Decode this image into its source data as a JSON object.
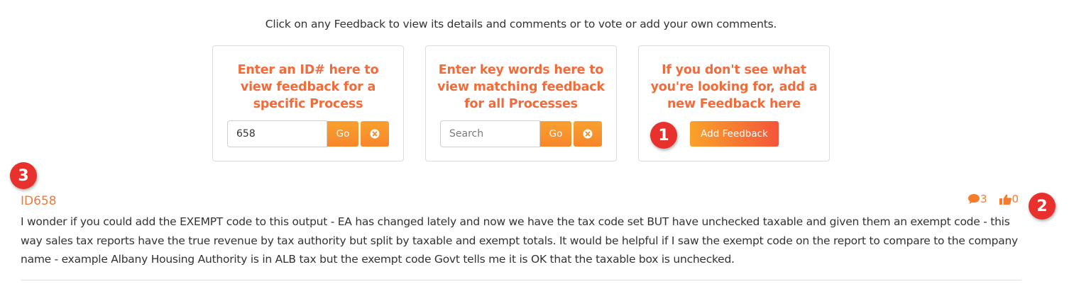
{
  "intro": "Click on any Feedback to view its details and comments or to vote or add your own comments.",
  "panels": {
    "id_search": {
      "title": "Enter an ID# here to view feedback for a specific Process",
      "input_value": "658",
      "go_label": "Go"
    },
    "keyword_search": {
      "title": "Enter key words here to view matching feedback for all Processes",
      "placeholder": "Search",
      "go_label": "Go"
    },
    "add_feedback": {
      "title": "If you don't see what you're looking for, add a new Feedback here",
      "button_label": "Add Feedback"
    }
  },
  "markers": [
    "1",
    "2",
    "3"
  ],
  "feedback": {
    "id": "ID658",
    "comments_count": "3",
    "votes_count": "0",
    "body": "I wonder if you could add the EXEMPT code to this output - EA has changed lately and now we have the tax code set BUT have unchecked taxable and given them an exempt code - this way sales tax reports have the true revenue by tax authority but split by taxable and exempt totals. It would be helpful if I saw the exempt code on the report to compare to the company name - example Albany Housing Authority is in ALB tax but the exempt code Govt tells me it is OK that the taxable box is unchecked."
  },
  "colors": {
    "accent_orange": "#f26b3a",
    "button_orange": "#f7862a",
    "marker_red": "#e8312c"
  },
  "icons": [
    "times-circle-icon",
    "comment-icon",
    "thumbs-up-icon"
  ]
}
